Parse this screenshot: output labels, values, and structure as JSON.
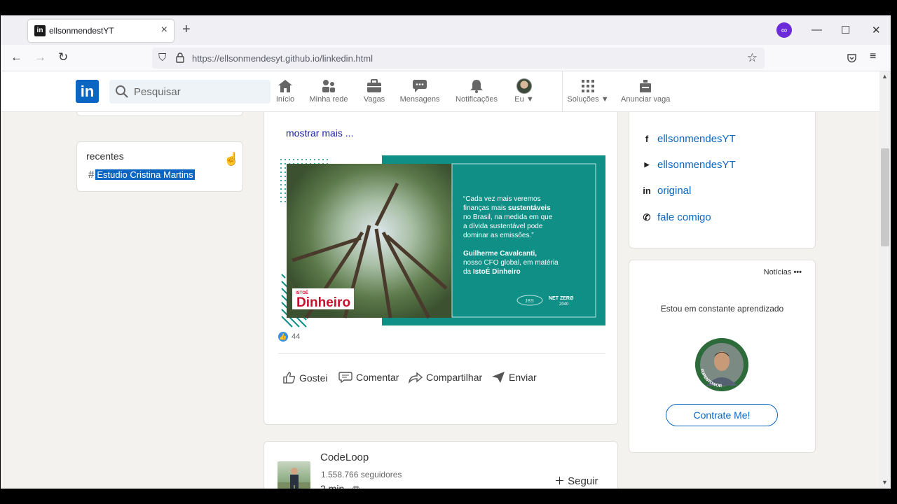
{
  "browser": {
    "tab_title": "ellsonmendestYT",
    "url": "https://ellsonmendesyt.github.io/linkedin.html",
    "new_tab": "+",
    "min": "—",
    "max": "☐",
    "close": "✕"
  },
  "header": {
    "logo": "in",
    "search_placeholder": "Pesquisar",
    "nav": [
      {
        "label": "Início"
      },
      {
        "label": "Minha rede"
      },
      {
        "label": "Vagas"
      },
      {
        "label": "Mensagens"
      },
      {
        "label": "Notificações"
      },
      {
        "label": "Eu"
      },
      {
        "label": "Soluções"
      },
      {
        "label": "Anunciar vaga"
      }
    ]
  },
  "left": {
    "recentes_title": "recentes",
    "recentes_item": "Estudio Cristina Martins"
  },
  "post": {
    "mostrar_mais": "mostrar mais ...",
    "image": {
      "quote_open": "“Cada vez mais veremos",
      "quote_l2_pre": "finanças mais ",
      "quote_l2_bold": "sustentáveis",
      "quote_l3": "no Brasil, na medida em que",
      "quote_l4": "a dívida sustentável pode",
      "quote_l5": "dominar as emissões.”",
      "author": "Guilherme Cavalcanti,",
      "author_l2": "nosso CFO global, em matéria",
      "author_l3_pre": "da ",
      "author_l3_bold": "IstoÉ Dinheiro",
      "brand": "Dinheiro",
      "brand_small": "ISTOÉ",
      "jbs": "JBS",
      "net_zero": "NET ZERØ",
      "net_zero_year": "2040"
    },
    "reactions": "44",
    "actions": {
      "like": "Gostei",
      "comment": "Comentar",
      "share": "Compartilhar",
      "send": "Enviar"
    }
  },
  "next_post": {
    "company": "CodeLoop",
    "followers": "1.558.766 seguidores",
    "time": "2 min .",
    "follow": "Seguir"
  },
  "right": {
    "links": [
      {
        "icon": "facebook-icon",
        "label": "ellsonmendesYT"
      },
      {
        "icon": "youtube-icon",
        "label": "ellsonmendesYT"
      },
      {
        "icon": "linkedin-icon",
        "label": "original"
      },
      {
        "icon": "whatsapp-icon",
        "label": "fale comigo"
      }
    ],
    "news_label": "Notícias",
    "aprendizado": "Estou em constante aprendizado",
    "badge_text": "#OPENTOWORK",
    "cta": "Contrate Me!"
  },
  "colors": {
    "linkedin_blue": "#0a66c2",
    "teal": "#0f8f86",
    "page_bg": "#f3f2ef"
  }
}
